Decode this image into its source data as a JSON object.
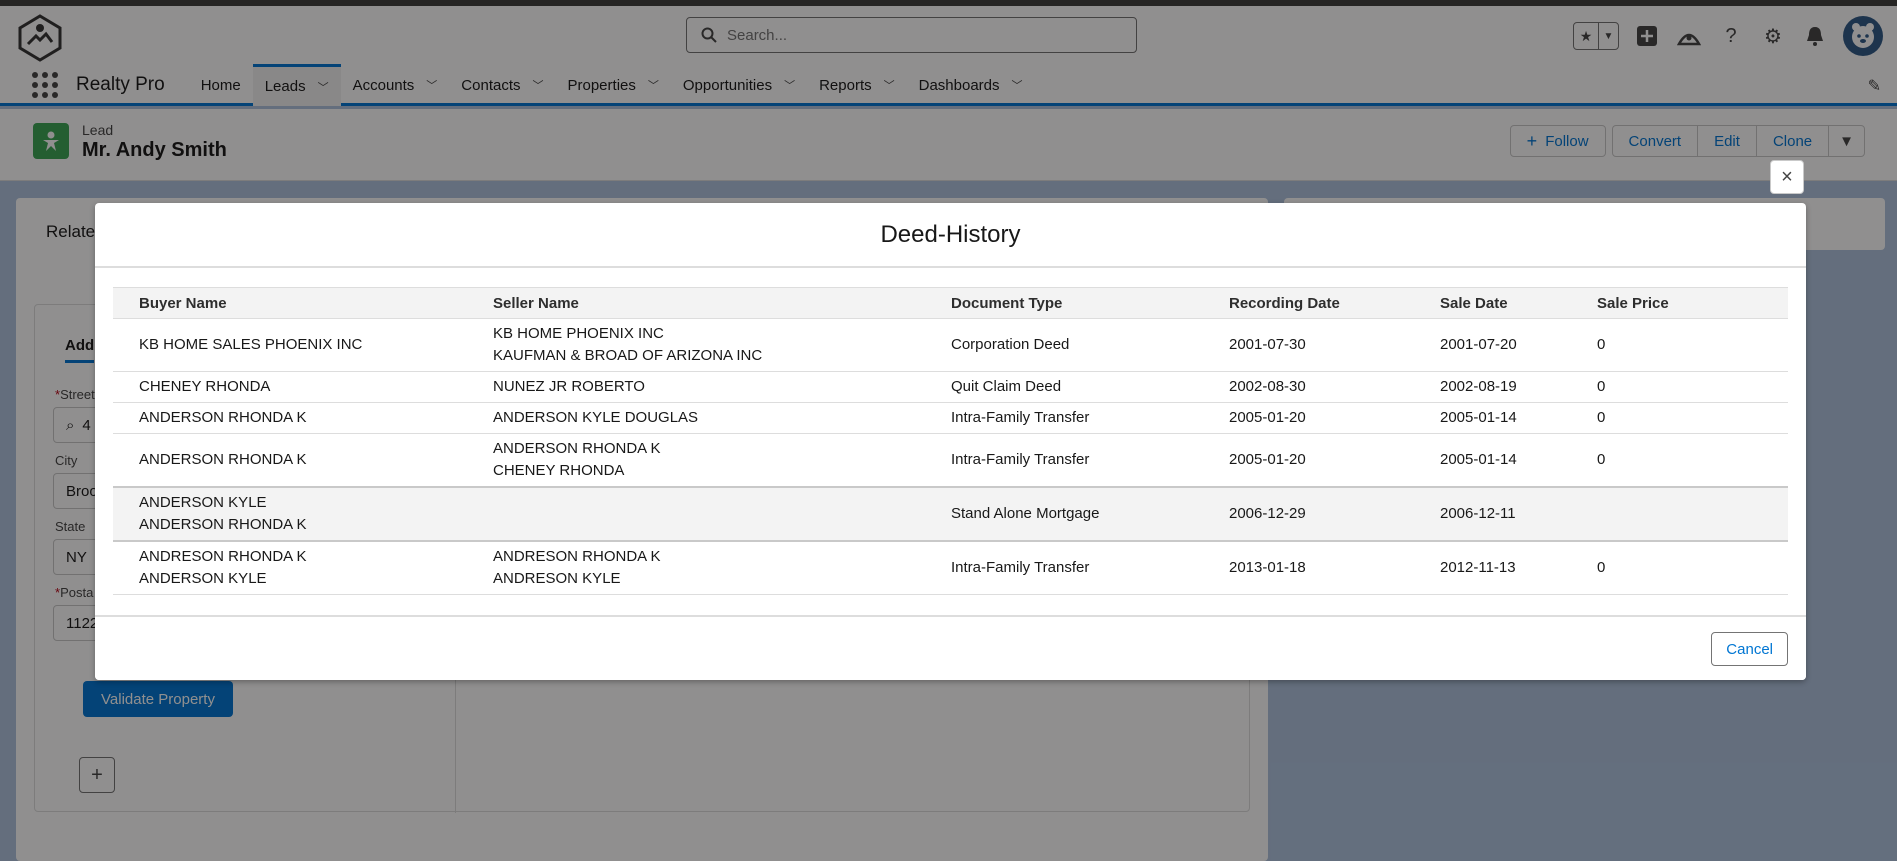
{
  "header": {
    "search_placeholder": "Search...",
    "app_name": "Realty Pro"
  },
  "nav": {
    "items": [
      {
        "label": "Home",
        "dropdown": false
      },
      {
        "label": "Leads",
        "dropdown": true,
        "active": true
      },
      {
        "label": "Accounts",
        "dropdown": true
      },
      {
        "label": "Contacts",
        "dropdown": true
      },
      {
        "label": "Properties",
        "dropdown": true
      },
      {
        "label": "Opportunities",
        "dropdown": true
      },
      {
        "label": "Reports",
        "dropdown": true
      },
      {
        "label": "Dashboards",
        "dropdown": true
      }
    ]
  },
  "record": {
    "type": "Lead",
    "name": "Mr. Andy Smith",
    "actions": {
      "follow": "Follow",
      "convert": "Convert",
      "edit": "Edit",
      "clone": "Clone"
    }
  },
  "background_form": {
    "related_tab": "Relate",
    "add_tab": "Add",
    "street_label": "Street",
    "street_value": "4",
    "city_label": "City",
    "city_value": "Broo",
    "state_label": "State",
    "state_value": "NY",
    "postal_label": "Posta",
    "postal_value": "1122",
    "validate_button": "Validate Property"
  },
  "modal": {
    "title": "Deed-History",
    "columns": [
      "Buyer Name",
      "Seller Name",
      "Document Type",
      "Recording Date",
      "Sale Date",
      "Sale Price"
    ],
    "rows": [
      {
        "buyer": [
          "KB HOME SALES PHOENIX INC"
        ],
        "seller": [
          "KB HOME PHOENIX INC",
          "KAUFMAN & BROAD OF ARIZONA INC"
        ],
        "doc_type": "Corporation Deed",
        "recording_date": "2001-07-30",
        "sale_date": "2001-07-20",
        "sale_price": "0"
      },
      {
        "buyer": [
          "CHENEY RHONDA"
        ],
        "seller": [
          "NUNEZ JR ROBERTO"
        ],
        "doc_type": "Quit Claim Deed",
        "recording_date": "2002-08-30",
        "sale_date": "2002-08-19",
        "sale_price": "0"
      },
      {
        "buyer": [
          "ANDERSON RHONDA K"
        ],
        "seller": [
          "ANDERSON KYLE DOUGLAS"
        ],
        "doc_type": "Intra-Family Transfer",
        "recording_date": "2005-01-20",
        "sale_date": "2005-01-14",
        "sale_price": "0"
      },
      {
        "buyer": [
          "ANDERSON RHONDA K"
        ],
        "seller": [
          "ANDERSON RHONDA K",
          "CHENEY RHONDA"
        ],
        "doc_type": "Intra-Family Transfer",
        "recording_date": "2005-01-20",
        "sale_date": "2005-01-14",
        "sale_price": "0"
      },
      {
        "buyer": [
          "ANDERSON KYLE",
          "ANDERSON RHONDA K"
        ],
        "seller": [],
        "doc_type": "Stand Alone Mortgage",
        "recording_date": "2006-12-29",
        "sale_date": "2006-12-11",
        "sale_price": "",
        "shaded": true
      },
      {
        "buyer": [
          "ANDRESON RHONDA K",
          "ANDERSON KYLE"
        ],
        "seller": [
          "ANDRESON RHONDA K",
          "ANDRESON KYLE"
        ],
        "doc_type": "Intra-Family Transfer",
        "recording_date": "2013-01-18",
        "sale_date": "2012-11-13",
        "sale_price": "0"
      }
    ],
    "cancel_label": "Cancel",
    "close_label": "×"
  },
  "colors": {
    "brand": "#0176d3",
    "lead_icon": "#3ba755"
  }
}
